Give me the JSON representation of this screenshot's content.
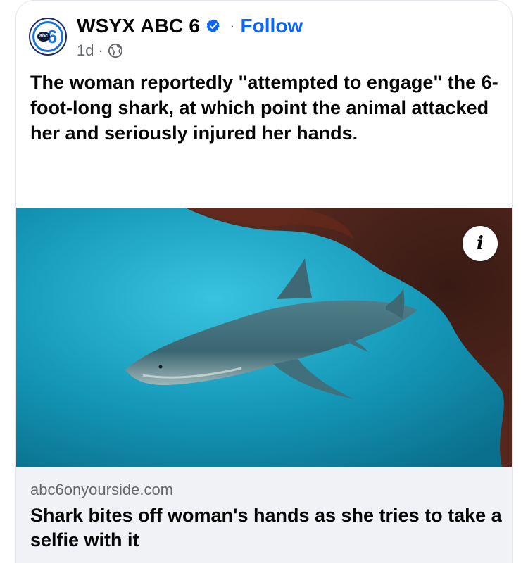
{
  "post": {
    "page_name": "WSYX ABC 6",
    "follow_label": "Follow",
    "separator": "·",
    "time": "1d",
    "audience_icon": "globe-icon",
    "verified_icon": "verified-badge-icon",
    "avatar_text_small": "abc",
    "avatar_text_number": "6",
    "text": "The woman reportedly \"attempted to engage\" the 6-foot-long shark, at which point the animal attacked her and seriously injured her hands."
  },
  "link": {
    "domain": "abc6onyourside.com",
    "title": "Shark bites off woman's hands as she tries to take a selfie with it",
    "info_icon_glyph": "i"
  },
  "colors": {
    "follow": "#0866ff",
    "verified": "#0866ff",
    "secondary_text": "#65676b",
    "link_box_bg": "#f0f2f5",
    "water": "#1fa3c6",
    "blood": "#4a1b12"
  }
}
